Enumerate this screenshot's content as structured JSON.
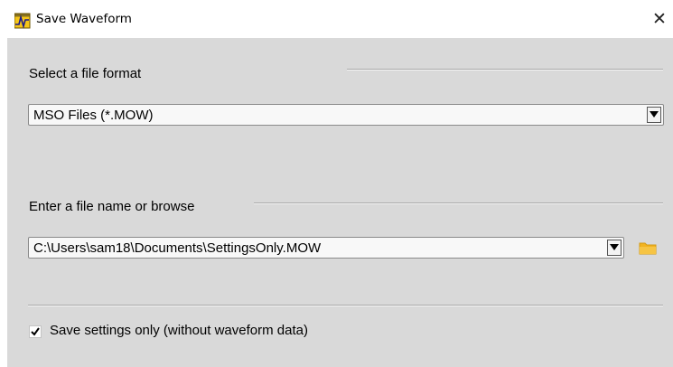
{
  "window": {
    "title": "Save Waveform",
    "close_glyph": "✕",
    "app_icon": "waveform-app-icon"
  },
  "format_section": {
    "label": "Select a file format",
    "selected": "MSO Files (*.MOW)"
  },
  "filename_section": {
    "label": "Enter a file name or browse",
    "value": "C:\\Users\\sam18\\Documents\\SettingsOnly.MOW",
    "browse_icon": "folder-icon"
  },
  "options": {
    "settings_only_label": "Save settings only (without waveform data)",
    "settings_only_checked": true
  },
  "colors": {
    "panel_bg": "#d9d9d9",
    "folder": "#f2b321"
  }
}
